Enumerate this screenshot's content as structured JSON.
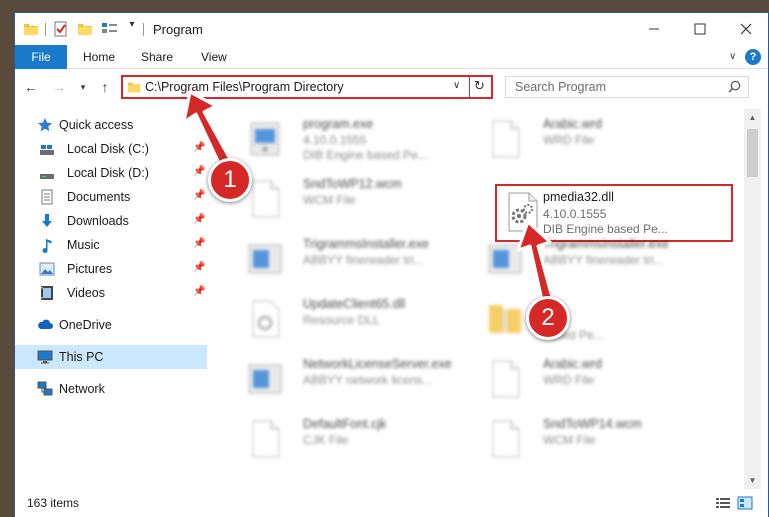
{
  "window": {
    "title": "Program"
  },
  "ribbon": {
    "file": "File",
    "home": "Home",
    "share": "Share",
    "view": "View",
    "help": "?"
  },
  "address": {
    "path": "C:\\Program Files\\Program Directory"
  },
  "search": {
    "placeholder": "Search Program"
  },
  "sidebar": {
    "items": [
      {
        "label": "Quick access",
        "icon": "star-icon"
      },
      {
        "label": "Local Disk (C:)",
        "icon": "drive-icon",
        "pinned": true
      },
      {
        "label": "Local Disk (D:)",
        "icon": "drive-icon",
        "pinned": true
      },
      {
        "label": "Documents",
        "icon": "documents-icon",
        "pinned": true
      },
      {
        "label": "Downloads",
        "icon": "download-icon",
        "pinned": true
      },
      {
        "label": "Music",
        "icon": "music-icon",
        "pinned": true
      },
      {
        "label": "Pictures",
        "icon": "pictures-icon",
        "pinned": true
      },
      {
        "label": "Videos",
        "icon": "videos-icon",
        "pinned": true
      },
      {
        "label": "OneDrive",
        "icon": "cloud-icon"
      },
      {
        "label": "This PC",
        "icon": "computer-icon",
        "selected": true
      },
      {
        "label": "Network",
        "icon": "network-icon"
      }
    ]
  },
  "files": [
    {
      "name": "program.exe",
      "line1": "4.10.0.1555",
      "line2": "DIB Engine based Pe...",
      "icon": "exe-icon"
    },
    {
      "name": "Arabic.wrd",
      "line1": "WRD File",
      "line2": "",
      "icon": "file-icon"
    },
    {
      "name": "SndToWP12.wcm",
      "line1": "WCM File",
      "line2": "",
      "icon": "file-icon"
    },
    {
      "name": "pmedia32.dll",
      "line1": "4.10.0.1555",
      "line2": "DIB Engine based Pe...",
      "icon": "dll-gear-icon"
    },
    {
      "name": "TrigrammsInstaller.exe",
      "line1": "ABBYY finereader tri...",
      "line2": "",
      "icon": "installer-icon"
    },
    {
      "name": "TrigrammsInstaller.exe",
      "line1": "ABBYY finereader tri...",
      "line2": "",
      "icon": "installer-icon"
    },
    {
      "name": "UpdateClient65.dll",
      "line1": "Resource DLL",
      "line2": "",
      "icon": "dll-icon"
    },
    {
      "name": "",
      "line1": "1555",
      "line2": "based Pe...",
      "icon": "zip-icon"
    },
    {
      "name": "NetworkLicenseServer.exe",
      "line1": "ABBYY network licens...",
      "line2": "",
      "icon": "installer-icon"
    },
    {
      "name": "Arabic.wrd",
      "line1": "WRD File",
      "line2": "",
      "icon": "file-icon"
    },
    {
      "name": "DefaultFont.cjk",
      "line1": "CJK File",
      "line2": "",
      "icon": "file-icon"
    },
    {
      "name": "SndToWP14.wcm",
      "line1": "WCM File",
      "line2": "",
      "icon": "file-icon"
    }
  ],
  "status": {
    "count": "163 items"
  },
  "annotations": {
    "step1": "1",
    "step2": "2"
  },
  "colors": {
    "accent": "#1979ca",
    "highlight": "#d72828",
    "selected": "#cce8ff"
  }
}
